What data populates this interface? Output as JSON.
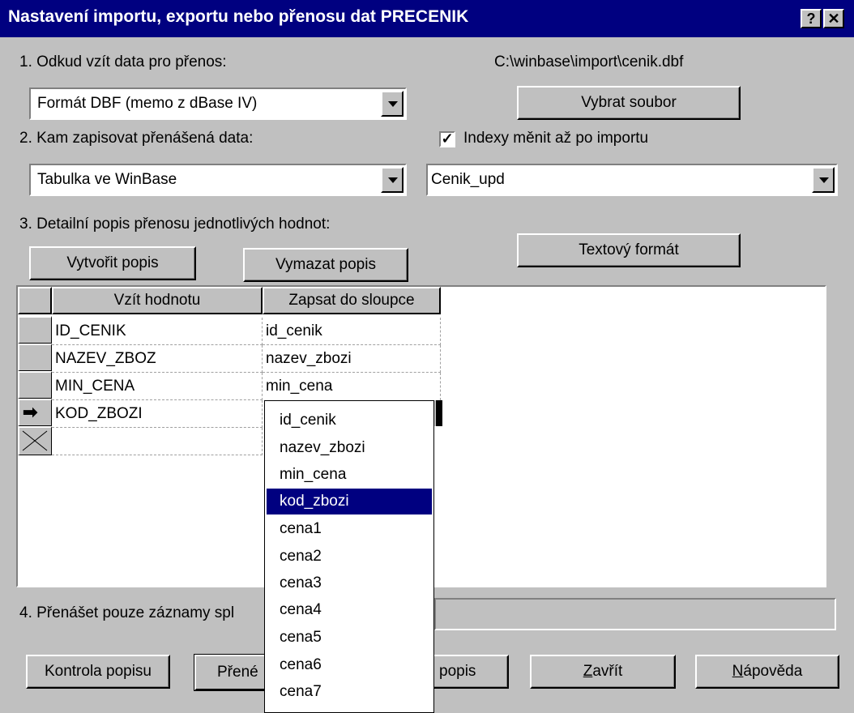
{
  "window": {
    "title": "Nastavení importu, exportu nebo přenosu dat PRECENIK",
    "help_btn": "?",
    "close_btn": "✕"
  },
  "step1": {
    "label": "1. Odkud vzít data pro přenos:",
    "file_path": "C:\\winbase\\import\\cenik.dbf",
    "source_format": "Formát DBF (memo z dBase IV)",
    "select_file_button": "Vybrat soubor"
  },
  "step2": {
    "label": "2. Kam zapisovat přenášená data:",
    "index_checkbox_label": "Indexy měnit až po importu",
    "index_checked": true,
    "target_type": "Tabulka ve WinBase",
    "target_table": "Cenik_upd"
  },
  "step3": {
    "label": "3. Detailní popis přenosu jednotlivých hodnot:",
    "create_button": "Vytvořit popis",
    "clear_button": "Vymazat popis",
    "text_format_button": "Textový formát",
    "columns": [
      "Vzít hodnotu",
      "Zapsat do sloupce"
    ],
    "rows": [
      {
        "source": "ID_CENIK",
        "target": "id_cenik"
      },
      {
        "source": "NAZEV_ZBOZ",
        "target": "nazev_zbozi"
      },
      {
        "source": "MIN_CENA",
        "target": "min_cena"
      },
      {
        "source": "KOD_ZBOZI",
        "target": ""
      }
    ],
    "dropdown_options": [
      "id_cenik",
      "nazev_zbozi",
      "min_cena",
      "kod_zbozi",
      "cena1",
      "cena2",
      "cena3",
      "cena4",
      "cena5",
      "cena6",
      "cena7"
    ],
    "dropdown_selected": "kod_zbozi"
  },
  "step4": {
    "label": "4. Přenášet pouze záznamy spl"
  },
  "footer": {
    "check_button": "Kontrola popisu",
    "transfer_button": "Přené",
    "save_button_tail": "popis",
    "close_button": "Zavřít",
    "help_button": "Nápověda"
  }
}
